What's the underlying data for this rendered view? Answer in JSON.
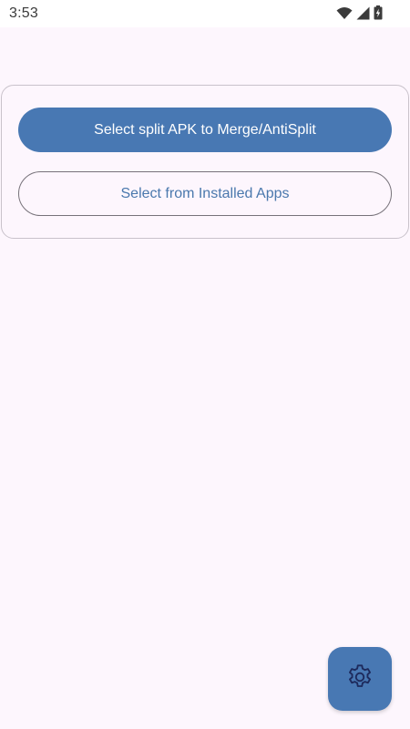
{
  "status_bar": {
    "time": "3:53",
    "icons": [
      "wifi-icon",
      "signal-icon",
      "battery-charging-icon"
    ]
  },
  "main": {
    "primary_button_label": "Select split APK to Merge/AntiSplit",
    "secondary_button_label": "Select from Installed Apps"
  },
  "fab": {
    "icon": "settings-gear-icon"
  },
  "colors": {
    "background": "#fdf6fd",
    "primary": "#4878b3",
    "outline_text": "#4a78ad",
    "outline_border": "#77727a",
    "fab_icon": "#1d2a5c"
  }
}
